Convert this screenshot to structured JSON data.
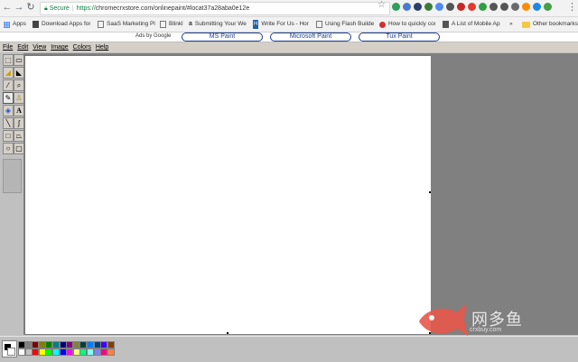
{
  "browser": {
    "url_scheme": "https://",
    "url_rest": "chromecrxstore.com/onlinepaint/#locat37a28aba0e12e",
    "secure_label": "Secure",
    "bookmarks": [
      {
        "label": "Apps",
        "icon": "apps-grid-icon"
      },
      {
        "label": "Download Apps for",
        "icon": "page-icon"
      },
      {
        "label": "SaaS Marketing Pla",
        "icon": "page-icon"
      },
      {
        "label": "Blinkl",
        "icon": "page-icon"
      },
      {
        "label": "Submitting Your We",
        "icon": "amazon-icon"
      },
      {
        "label": "Write For Us - Hong",
        "icon": "h-logo-icon"
      },
      {
        "label": "Using Flash Builder",
        "icon": "page-icon"
      },
      {
        "label": "How to quickly con",
        "icon": "red-logo-icon"
      },
      {
        "label": "A List of Mobile App",
        "icon": "book-icon"
      },
      {
        "label": "Other bookmarks",
        "icon": "folder-icon"
      }
    ],
    "overflow_label": "»"
  },
  "ads": {
    "label": "Ads by Google",
    "links": [
      "MS Paint",
      "Microsoft Paint",
      "Tux Paint"
    ],
    "border_color": "#1a3f8f"
  },
  "paint": {
    "menus": [
      "File",
      "Edit",
      "View",
      "Image",
      "Colors",
      "Help"
    ],
    "tools": [
      {
        "name": "free-select-icon",
        "glyph": "⬚"
      },
      {
        "name": "rect-select-icon",
        "glyph": "▭"
      },
      {
        "name": "eraser-icon",
        "glyph": "◢"
      },
      {
        "name": "fill-bucket-icon",
        "glyph": "◣"
      },
      {
        "name": "color-picker-icon",
        "glyph": "⁄"
      },
      {
        "name": "magnifier-icon",
        "glyph": "⌕"
      },
      {
        "name": "pencil-icon",
        "glyph": "✎"
      },
      {
        "name": "brush-icon",
        "glyph": "♙"
      },
      {
        "name": "airbrush-icon",
        "glyph": "◈"
      },
      {
        "name": "text-icon",
        "glyph": "A"
      },
      {
        "name": "line-icon",
        "glyph": "╲"
      },
      {
        "name": "curve-icon",
        "glyph": "∫"
      },
      {
        "name": "rectangle-icon",
        "glyph": "□"
      },
      {
        "name": "polygon-icon",
        "glyph": "⏢"
      },
      {
        "name": "ellipse-icon",
        "glyph": "○"
      },
      {
        "name": "rounded-rect-icon",
        "glyph": "▢"
      }
    ],
    "palette_top": [
      "#000000",
      "#808080",
      "#800000",
      "#808000",
      "#008000",
      "#008080",
      "#000080",
      "#800080",
      "#808040",
      "#004040",
      "#0080ff",
      "#004080",
      "#4000ff",
      "#804000"
    ],
    "palette_bottom": [
      "#ffffff",
      "#c0c0c0",
      "#ff0000",
      "#ffff00",
      "#00ff00",
      "#00ffff",
      "#0000ff",
      "#ff00ff",
      "#ffff80",
      "#00ff80",
      "#80ffff",
      "#8080ff",
      "#ff0080",
      "#ff8040"
    ],
    "foreground_color": "#000000",
    "background_color": "#ffffff",
    "canvas_color": "#ffffff",
    "workspace_color": "#808080"
  },
  "watermark": {
    "text": "网多鱼",
    "url": "crxbuy.com"
  }
}
